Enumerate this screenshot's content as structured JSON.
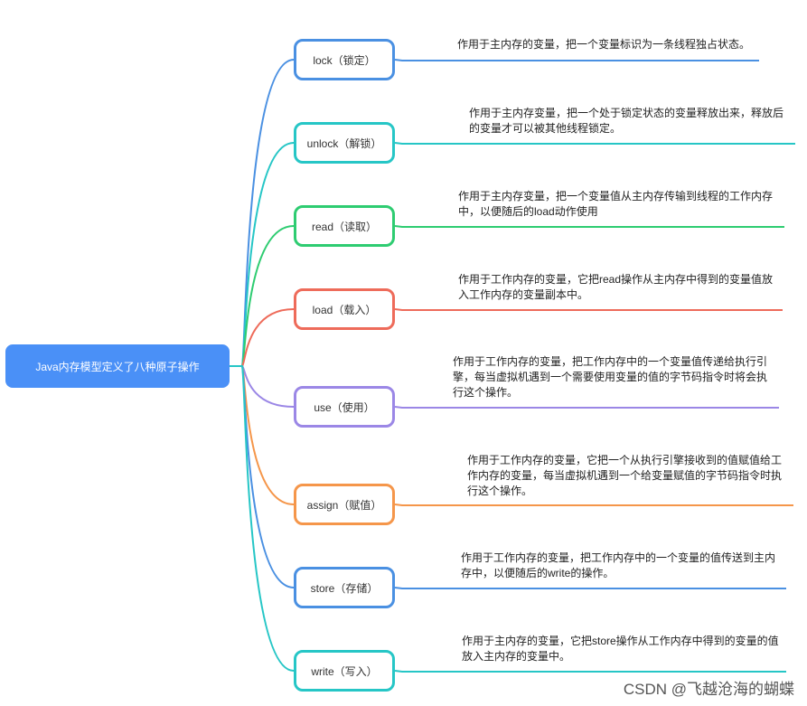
{
  "root": {
    "label": "Java内存模型定义了八种原子操作",
    "color": "#4a90f7"
  },
  "operations": [
    {
      "label": "lock（锁定）",
      "color": "#4a90e2",
      "description": "作用于主内存的变量，把一个变量标识为一条线程独占状态。"
    },
    {
      "label": "unlock（解锁）",
      "color": "#26c6c6",
      "description": "作用于主内存变量，把一个处于锁定状态的变量释放出来，释放后的变量才可以被其他线程锁定。"
    },
    {
      "label": "read（读取）",
      "color": "#2ecc71",
      "description": "作用于主内存变量，把一个变量值从主内存传输到线程的工作内存中，以便随后的load动作使用"
    },
    {
      "label": "load（载入）",
      "color": "#ee6b5a",
      "description": "作用于工作内存的变量，它把read操作从主内存中得到的变量值放入工作内存的变量副本中。"
    },
    {
      "label": "use（使用）",
      "color": "#9b87e6",
      "description": "作用于工作内存的变量，把工作内存中的一个变量值传递给执行引擎，每当虚拟机遇到一个需要使用变量的值的字节码指令时将会执行这个操作。"
    },
    {
      "label": "assign（赋值）",
      "color": "#f5964a",
      "description": "作用于工作内存的变量，它把一个从执行引擎接收到的值赋值给工作内存的变量，每当虚拟机遇到一个给变量赋值的字节码指令时执行这个操作。"
    },
    {
      "label": "store（存储）",
      "color": "#4a90e2",
      "description": "作用于工作内存的变量，把工作内存中的一个变量的值传送到主内存中，以便随后的write的操作。"
    },
    {
      "label": "write（写入）",
      "color": "#26c6c6",
      "description": "作用于主内存的变量，它把store操作从工作内存中得到的变量的值放入主内存的变量中。"
    }
  ],
  "watermark": "CSDN @飞越沧海的蝴蝶"
}
